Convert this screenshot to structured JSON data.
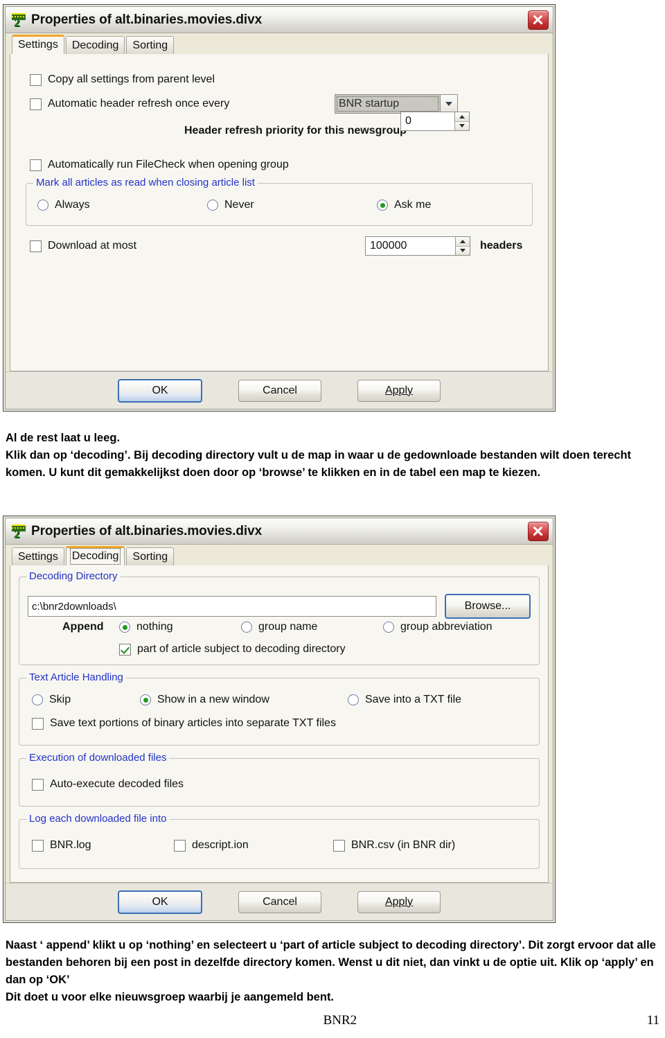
{
  "document": {
    "paragraph1": [
      "Al de rest laat u leeg.",
      "Klik dan op ‘decoding’.  Bij decoding directory vult u de map in waar u de gedownloade bestanden wilt doen terecht komen. U kunt dit gemakkelijkst doen door op ‘browse’ te klikken en in de tabel een map te kiezen."
    ],
    "paragraph2": [
      "Naast ‘ append’ klikt u op ‘nothing’ en selecteert u ‘part of article subject to decoding directory’. Dit zorgt ervoor dat alle bestanden behoren bij een post in dezelfde directory komen. Wenst u dit niet, dan vinkt u de optie uit. Klik op ‘apply’ en dan op ‘OK’",
      "Dit doet u voor elke nieuwsgroep waarbij je aangemeld bent."
    ],
    "footer_title": "BNR2",
    "page_number": "11"
  },
  "colors": {
    "active_tab_accent": "#f0a52a",
    "groupbox_label": "#2433c7",
    "radio_dot": "#1f9b1f",
    "check_mark": "#1f8a1f",
    "close_button": "#c02f2f",
    "default_button_border": "#3c6fb4"
  },
  "dialog_settings": {
    "title": "Properties of alt.binaries.movies.divx",
    "app_icon": "bnr2-logo-icon",
    "close_icon": "close-icon",
    "tabs": [
      {
        "label": "Settings",
        "active": true
      },
      {
        "label": "Decoding",
        "active": false
      },
      {
        "label": "Sorting",
        "active": false
      }
    ],
    "copy_settings": {
      "label": "Copy all settings from parent level",
      "checked": false
    },
    "auto_refresh": {
      "label": "Automatic header refresh once every",
      "checked": false
    },
    "refresh_interval": {
      "value": "BNR startup",
      "icon": "chevron-down-icon"
    },
    "priority": {
      "label": "Header refresh priority for this newsgroup",
      "value": "0"
    },
    "filecheck": {
      "label": "Automatically run FileCheck when opening group",
      "checked": false
    },
    "mark_read_group": {
      "title": "Mark all articles as read when closing article list",
      "options": [
        {
          "label": "Always",
          "selected": false
        },
        {
          "label": "Never",
          "selected": false
        },
        {
          "label": "Ask me",
          "selected": true
        }
      ]
    },
    "download_at_most": {
      "label": "Download at most",
      "checked": false,
      "value": "100000",
      "unit": "headers"
    },
    "buttons": [
      {
        "label": "OK",
        "default": true
      },
      {
        "label": "Cancel",
        "default": false
      },
      {
        "label": "Apply",
        "default": false,
        "accesskey": "A"
      }
    ]
  },
  "dialog_decoding": {
    "title": "Properties of alt.binaries.movies.divx",
    "app_icon": "bnr2-logo-icon",
    "close_icon": "close-icon",
    "tabs": [
      {
        "label": "Settings",
        "active": false
      },
      {
        "label": "Decoding",
        "active": true
      },
      {
        "label": "Sorting",
        "active": false
      }
    ],
    "decoding_directory": {
      "title": "Decoding Directory",
      "path": "c:\\bnr2downloads\\",
      "browse_label": "Browse...",
      "append_label": "Append",
      "append_options": [
        {
          "label": "nothing",
          "selected": true
        },
        {
          "label": "group name",
          "selected": false
        },
        {
          "label": "group abbreviation",
          "selected": false
        }
      ],
      "subject_checkbox": {
        "label": "part of article subject to decoding directory",
        "checked": true
      }
    },
    "text_article_handling": {
      "title": "Text Article Handling",
      "options": [
        {
          "label": "Skip",
          "selected": false
        },
        {
          "label": "Show in a new window",
          "selected": true
        },
        {
          "label": "Save into a TXT file",
          "selected": false
        }
      ],
      "save_text_portions": {
        "label": "Save text portions of binary articles into separate TXT files",
        "checked": false
      }
    },
    "execution": {
      "title": "Execution of downloaded files",
      "auto_execute": {
        "label": "Auto-execute decoded files",
        "checked": false
      }
    },
    "logging": {
      "title": "Log each downloaded file into",
      "options": [
        {
          "label": "BNR.log",
          "checked": false
        },
        {
          "label": "descript.ion",
          "checked": false
        },
        {
          "label": "BNR.csv (in BNR dir)",
          "checked": false
        }
      ]
    },
    "buttons": [
      {
        "label": "OK",
        "default": true
      },
      {
        "label": "Cancel",
        "default": false
      },
      {
        "label": "Apply",
        "default": false,
        "accesskey": "A"
      }
    ]
  }
}
